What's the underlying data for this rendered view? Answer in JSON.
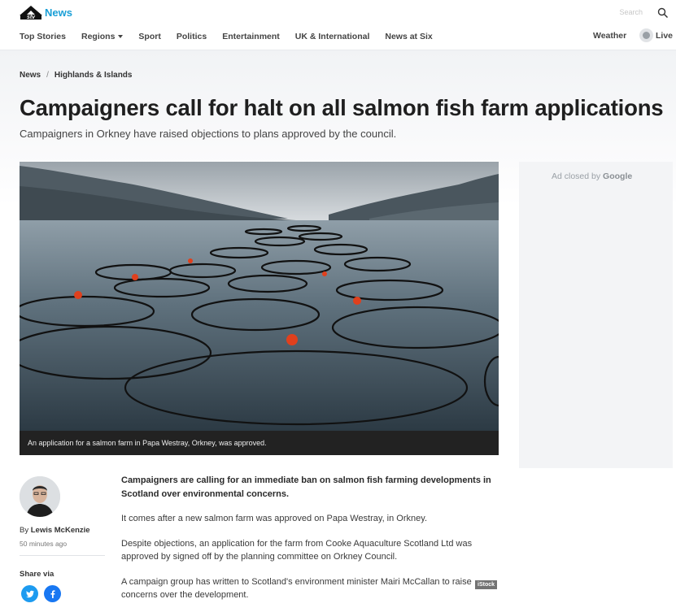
{
  "header": {
    "logo_text": "News",
    "search_placeholder": "Search",
    "nav": [
      {
        "label": "Top Stories"
      },
      {
        "label": "Regions",
        "has_dropdown": true
      },
      {
        "label": "Sport"
      },
      {
        "label": "Politics"
      },
      {
        "label": "Entertainment"
      },
      {
        "label": "UK & International"
      },
      {
        "label": "News at Six"
      }
    ],
    "weather_label": "Weather",
    "live_label": "Live"
  },
  "breadcrumb": [
    "News",
    "Highlands & Islands"
  ],
  "article": {
    "headline": "Campaigners call for halt on all salmon fish farm applications",
    "subheadline": "Campaigners in Orkney have raised objections to plans approved by the council.",
    "image_credit": "iStock",
    "image_caption": "An application for a salmon farm in Papa Westray, Orkney, was approved.",
    "lead": "Campaigners are calling for an immediate ban on salmon fish farming developments in Scotland over environmental concerns.",
    "paragraphs": [
      "It comes after a new salmon farm was approved on Papa Westray, in Orkney.",
      "Despite objections, an application for the farm from Cooke Aquaculture Scotland Ltd was approved by signed off by the planning committee on Orkney Council.",
      "A campaign group has written to Scotland's environment minister Mairi McCallan to raise concerns over the development."
    ]
  },
  "author": {
    "by": "By",
    "name": "Lewis McKenzie",
    "time": "50 minutes ago"
  },
  "share": {
    "label": "Share via",
    "icons": [
      "twitter-icon",
      "facebook-icon"
    ]
  },
  "ad": {
    "text": "Ad closed by",
    "brand": "Google"
  },
  "colors": {
    "accent": "#1a9fd6",
    "twitter": "#1d9bf0",
    "facebook": "#1877f2"
  }
}
